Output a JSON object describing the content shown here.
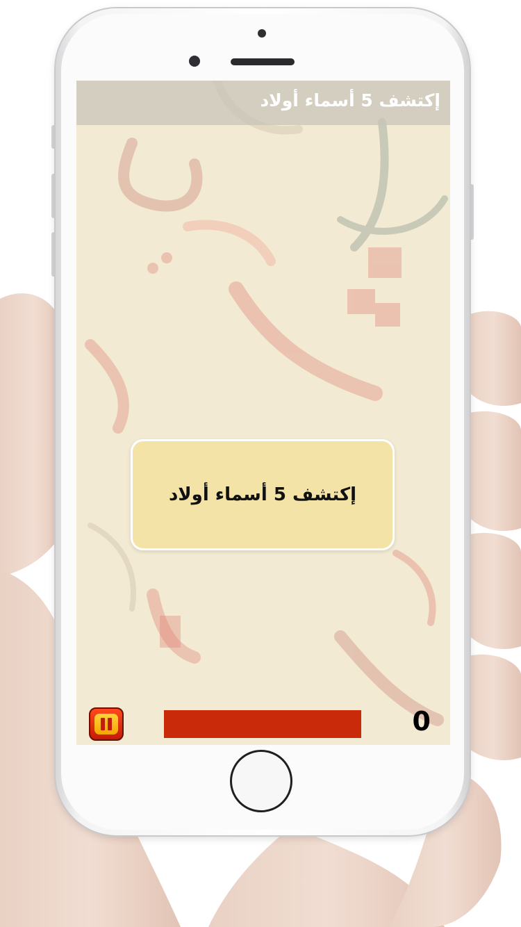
{
  "game": {
    "title": "إكتشف 5 أسماء أولاد",
    "task_text": "إكتشف 5 أسماء أولاد",
    "score": "0",
    "timer_progress": 1.0
  },
  "controls": {
    "pause_icon": "pause-icon"
  },
  "colors": {
    "screen_bg": "#f2ead3",
    "card_bg": "#f4e3a6",
    "timer_bar": "#b02408",
    "pause_button": "#e3340f",
    "pause_inner": "#f7b800"
  }
}
